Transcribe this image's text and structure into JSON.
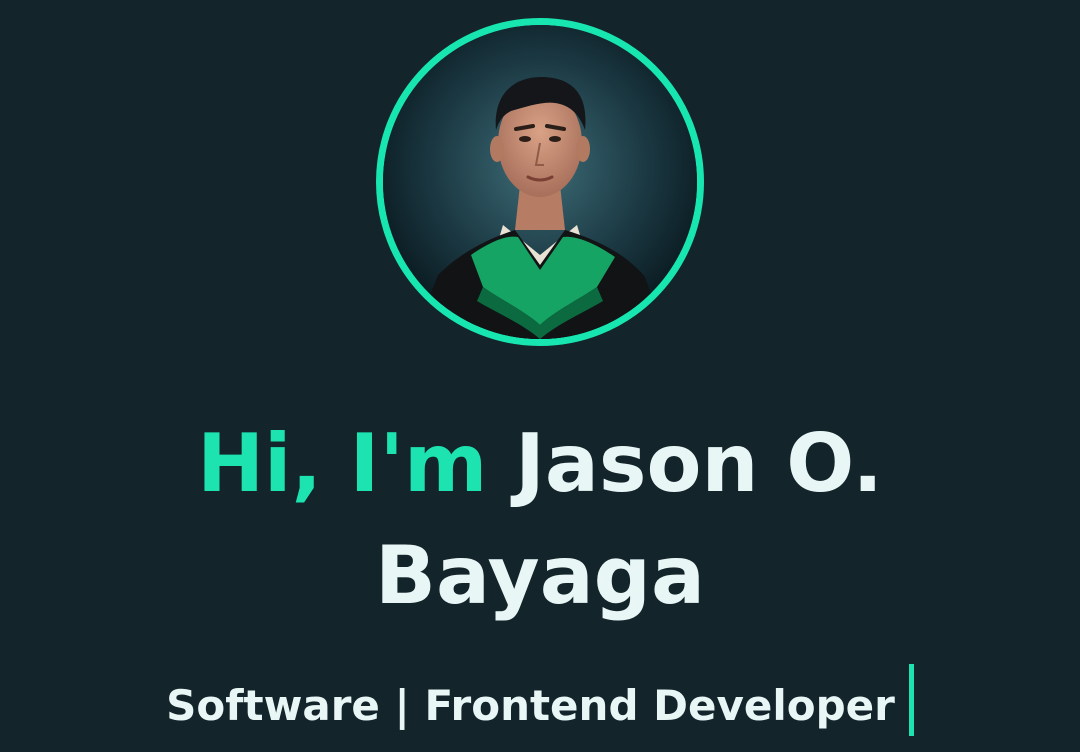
{
  "hero": {
    "greeting": "Hi, I'm",
    "name_line1": "Jason O.",
    "name_line2": "Bayaga",
    "subtitle": "Software | Frontend Developer"
  },
  "colors": {
    "background": "#13242a",
    "accent": "#1ce3b0",
    "text": "#e8f6f6"
  },
  "icons": {
    "profile_photo": "graduation-portrait-photo",
    "typing_cursor": "text-cursor"
  }
}
